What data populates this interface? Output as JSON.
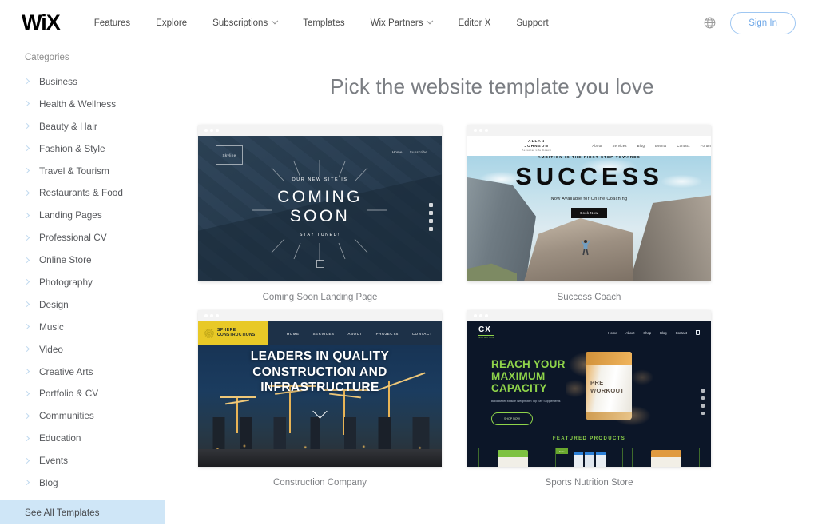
{
  "header": {
    "logo": "WiX",
    "nav": [
      {
        "label": "Features",
        "has_dropdown": false
      },
      {
        "label": "Explore",
        "has_dropdown": false
      },
      {
        "label": "Subscriptions",
        "has_dropdown": true
      },
      {
        "label": "Templates",
        "has_dropdown": false
      },
      {
        "label": "Wix Partners",
        "has_dropdown": true
      },
      {
        "label": "Editor X",
        "has_dropdown": false
      },
      {
        "label": "Support",
        "has_dropdown": false
      }
    ],
    "language_icon": "globe-icon",
    "sign_in_label": "Sign In",
    "sign_in_color": "#6fa8e8"
  },
  "sidebar": {
    "title": "Categories",
    "chevron_icon": "chevron-right-icon",
    "items": [
      {
        "label": "Business"
      },
      {
        "label": "Health & Wellness"
      },
      {
        "label": "Beauty & Hair"
      },
      {
        "label": "Fashion & Style"
      },
      {
        "label": "Travel & Tourism"
      },
      {
        "label": "Restaurants & Food"
      },
      {
        "label": "Landing Pages"
      },
      {
        "label": "Professional CV"
      },
      {
        "label": "Online Store"
      },
      {
        "label": "Photography"
      },
      {
        "label": "Design"
      },
      {
        "label": "Music"
      },
      {
        "label": "Video"
      },
      {
        "label": "Creative Arts"
      },
      {
        "label": "Portfolio & CV"
      },
      {
        "label": "Communities"
      },
      {
        "label": "Education"
      },
      {
        "label": "Events"
      },
      {
        "label": "Blog"
      }
    ],
    "see_all": {
      "label": "See All Templates",
      "highlight_color": "#cfe6f7"
    }
  },
  "main": {
    "title": "Pick the website template you love",
    "templates": [
      {
        "name": "coming-soon-landing-page",
        "label": "Coming Soon Landing Page",
        "preview": {
          "logo": "Skyline",
          "nav": [
            "Home",
            "Subscribe"
          ],
          "eyebrow": "OUR NEW SITE IS",
          "title_line_1": "COMING",
          "title_line_2": "SOON",
          "subtitle": "STAY TUNED!"
        }
      },
      {
        "name": "success-coach",
        "label": "Success Coach",
        "preview": {
          "logo_name": "ALLAN JOHNSON",
          "logo_tagline": "Personal Life Coach",
          "nav": [
            "About",
            "Services",
            "Blog",
            "Events",
            "Contact",
            "Forum"
          ],
          "eyebrow": "AMBITION IS THE FIRST STEP TOWARDS",
          "title": "SUCCESS",
          "subtitle": "Now Available for Online Coaching",
          "button": "Book Now"
        }
      },
      {
        "name": "construction-company",
        "label": "Construction Company",
        "preview": {
          "logo_line_1": "SPHERE",
          "logo_line_2": "CONSTRUCTIONS",
          "logo_bg": "#e8c927",
          "nav": [
            "HOME",
            "SERVICES",
            "ABOUT",
            "PROJECTS",
            "CONTACT"
          ],
          "headline": "LEADERS IN QUALITY CONSTRUCTION AND INFRASTRUCTURE",
          "scroll_icon": "chevron-down-icon"
        }
      },
      {
        "name": "sports-nutrition-store",
        "label": "Sports Nutrition Store",
        "preview": {
          "logo_mark": "CX",
          "logo_sub": "NUTRITION",
          "nav": [
            "Home",
            "About",
            "Shop",
            "Blog",
            "Contact"
          ],
          "cart_icon": "cart-icon",
          "headline_line_1": "REACH YOUR",
          "headline_line_2": "MAXIMUM",
          "headline_line_3": "CAPACITY",
          "subtitle": "Build Better Muscle Weight with Top Self Supplements",
          "button": "SHOP NOW",
          "product_name_line_1": "PRE",
          "product_name_line_2": "WORKOUT",
          "featured_heading": "FEATURED PRODUCTS",
          "accent_color": "#8fd44a",
          "sale_badge": "Sale"
        }
      }
    ]
  }
}
